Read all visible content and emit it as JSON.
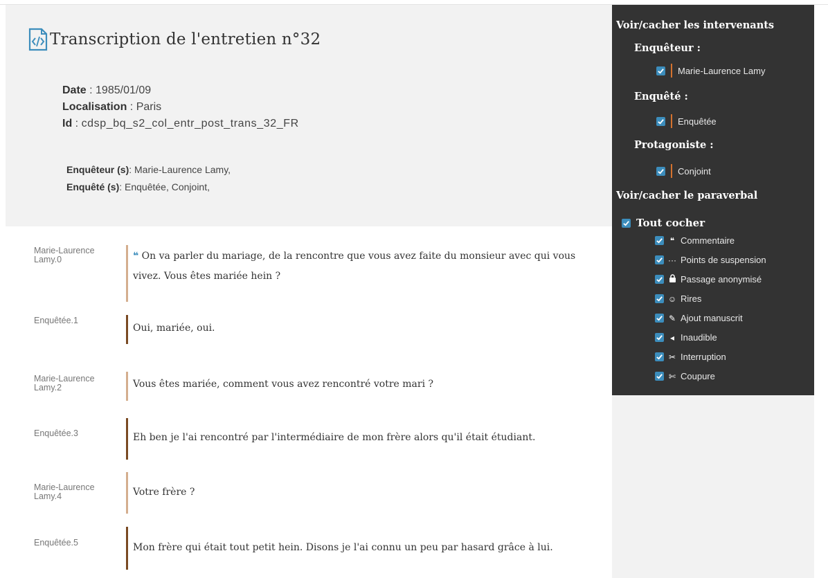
{
  "header": {
    "title": "Transcription de l'entretien n°32",
    "date_label": "Date",
    "date_value": "1985/01/09",
    "loc_label": "Localisation",
    "loc_value": "Paris",
    "id_label": "Id",
    "id_value": "cdsp_bq_s2_col_entr_post_trans_32_FR",
    "enqueteur_label": "Enquêteur (s)",
    "enqueteur_value": "Marie-Laurence Lamy,",
    "enquete_label": "Enquêté (s)",
    "enquete_value": "Enquêtée, Conjoint,"
  },
  "turns": [
    {
      "speaker": "Marie-Laurence Lamy.0",
      "text": "On va parler du mariage, de la rencontre que vous avez faite du monsieur avec qui vous vivez. Vous êtes mariée hein ?",
      "comment": true
    },
    {
      "speaker": "Enquêtée.1",
      "text": "Oui, mariée, oui."
    },
    {
      "speaker": "Marie-Laurence Lamy.2",
      "text": "Vous êtes mariée, comment vous avez rencontré votre mari ?"
    },
    {
      "speaker": "Enquêtée.3",
      "text": "Eh ben je l'ai rencontré par l'intermédiaire de mon frère alors qu'il était étudiant."
    },
    {
      "speaker": "Marie-Laurence Lamy.4",
      "text": "Votre frère ?"
    },
    {
      "speaker": "Enquêtée.5",
      "text": "Mon frère qui était tout petit hein. Disons je l'ai connu un peu par hasard grâce à lui."
    }
  ],
  "panel": {
    "intervenants_title": "Voir/cacher les intervenants",
    "enqueteur_heading": "Enquêteur :",
    "enqueteur_item": "Marie-Laurence Lamy",
    "enquete_heading": "Enquêté :",
    "enquete_item": "Enquêtée",
    "protagoniste_heading": "Protagoniste :",
    "protagoniste_item": "Conjoint",
    "paraverbal_title": "Voir/cacher le paraverbal",
    "tout_cocher": "Tout cocher",
    "paraverbal": [
      {
        "label": "Commentaire",
        "icon": "quote-icon"
      },
      {
        "label": "Points de suspension",
        "icon": "ellipsis-icon"
      },
      {
        "label": "Passage anonymisé",
        "icon": "lock-icon"
      },
      {
        "label": "Rires",
        "icon": "smile-icon"
      },
      {
        "label": "Ajout manuscrit",
        "icon": "pencil-icon"
      },
      {
        "label": "Inaudible",
        "icon": "volume-icon"
      },
      {
        "label": "Interruption",
        "icon": "scissors-icon"
      },
      {
        "label": "Coupure",
        "icon": "cut-icon"
      }
    ]
  },
  "colors": {
    "accent": "#3c8dbc",
    "panel_bg": "#333333",
    "interviewer_bar": "#d4ae8e",
    "interviewee_bar": "#7a4a23",
    "speaker_bar": "#d4722e"
  }
}
